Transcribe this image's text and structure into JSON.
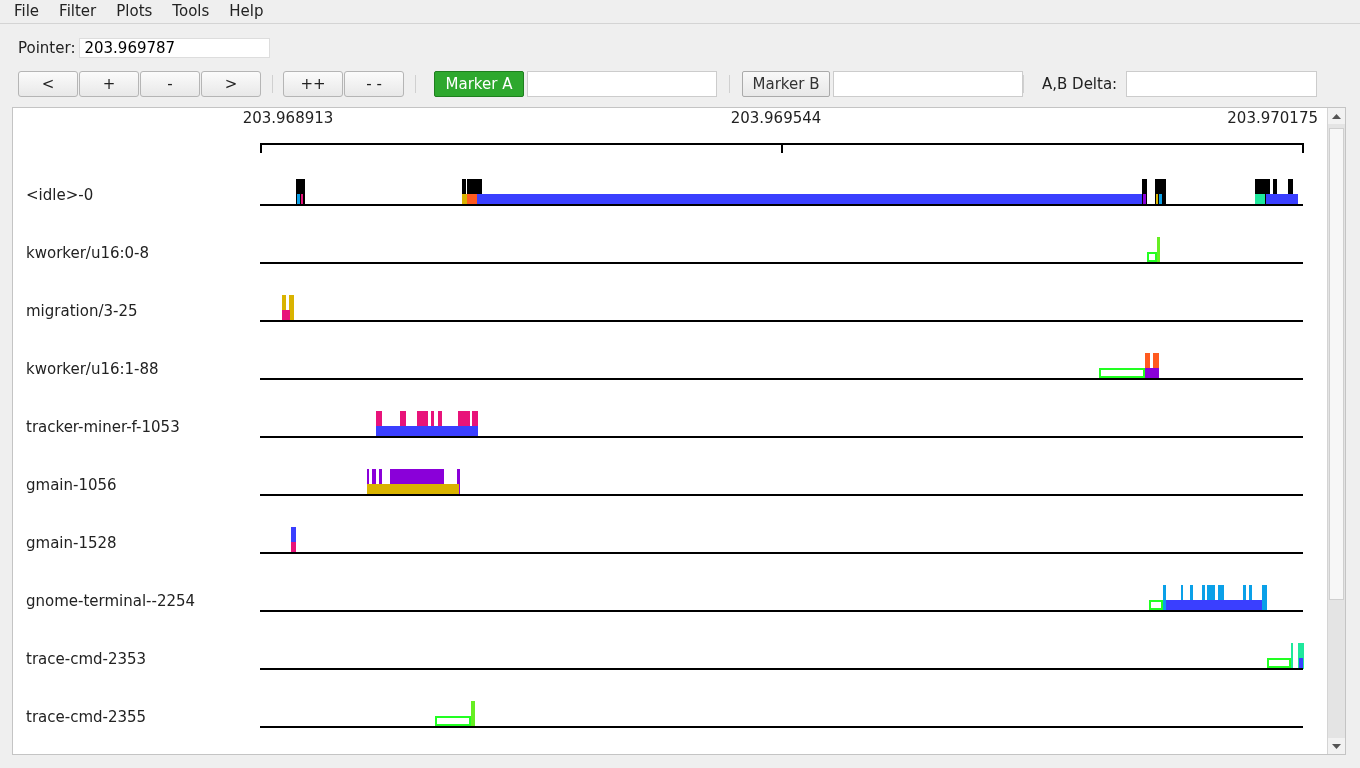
{
  "menu": [
    {
      "label": "File"
    },
    {
      "label": "Filter"
    },
    {
      "label": "Plots"
    },
    {
      "label": "Tools"
    },
    {
      "label": "Help"
    }
  ],
  "pointer": {
    "label": "Pointer:",
    "value": "203.969787"
  },
  "zoom_buttons": [
    "<",
    "+",
    "-",
    ">"
  ],
  "zoom_all_buttons": [
    "++",
    "- -"
  ],
  "marker_a": {
    "label": "Marker A",
    "selected": true
  },
  "marker_b": {
    "label": "Marker B",
    "selected": false
  },
  "delta": {
    "label": "A,B Delta:"
  },
  "axis": {
    "labels": [
      "203.968913",
      "203.969544",
      "203.970175"
    ]
  },
  "tasks": [
    {
      "name": "<idle>-0"
    },
    {
      "name": "kworker/u16:0-8"
    },
    {
      "name": "migration/3-25"
    },
    {
      "name": "kworker/u16:1-88"
    },
    {
      "name": "tracker-miner-f-1053"
    },
    {
      "name": "gmain-1056"
    },
    {
      "name": "gmain-1528"
    },
    {
      "name": "gnome-terminal--2254"
    },
    {
      "name": "trace-cmd-2353"
    },
    {
      "name": "trace-cmd-2355"
    }
  ]
}
